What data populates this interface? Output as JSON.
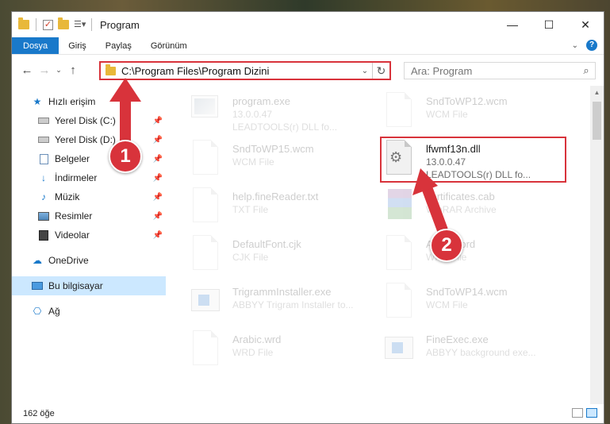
{
  "window": {
    "title": "Program",
    "controls": [
      "minimize",
      "maximize",
      "close"
    ]
  },
  "ribbon": {
    "tabs": [
      {
        "label": "Dosya",
        "active": true
      },
      {
        "label": "Giriş",
        "active": false
      },
      {
        "label": "Paylaş",
        "active": false
      },
      {
        "label": "Görünüm",
        "active": false
      }
    ]
  },
  "address": {
    "path": "C:\\Program Files\\Program Dizini"
  },
  "search": {
    "placeholder": "Ara: Program"
  },
  "nav": {
    "items": [
      {
        "label": "Hızlı erişim",
        "icon": "star-icon",
        "pinned": false
      },
      {
        "label": "Yerel Disk (C:)",
        "icon": "drive-icon",
        "pinned": true
      },
      {
        "label": "Yerel Disk (D:)",
        "icon": "drive-icon",
        "pinned": true
      },
      {
        "label": "Belgeler",
        "icon": "documents-icon",
        "pinned": true
      },
      {
        "label": "İndirmeler",
        "icon": "download-icon",
        "pinned": true
      },
      {
        "label": "Müzik",
        "icon": "music-icon",
        "pinned": true
      },
      {
        "label": "Resimler",
        "icon": "pictures-icon",
        "pinned": true
      },
      {
        "label": "Videolar",
        "icon": "videos-icon",
        "pinned": true
      },
      {
        "label": "OneDrive",
        "icon": "cloud-icon",
        "pinned": false
      },
      {
        "label": "Bu bilgisayar",
        "icon": "computer-icon",
        "pinned": false,
        "selected": true
      },
      {
        "label": "Ağ",
        "icon": "network-icon",
        "pinned": false
      }
    ]
  },
  "files": [
    {
      "name": "program.exe",
      "sub1": "13.0.0.47",
      "sub2": "LEADTOOLS(r) DLL fo...",
      "icon": "exe-icon",
      "highlighted": false
    },
    {
      "name": "SndToWP12.wcm",
      "sub1": "WCM File",
      "sub2": "",
      "icon": "file-icon",
      "highlighted": false
    },
    {
      "name": "SndToWP15.wcm",
      "sub1": "WCM File",
      "sub2": "",
      "icon": "file-icon",
      "highlighted": false
    },
    {
      "name": "lfwmf13n.dll",
      "sub1": "13.0.0.47",
      "sub2": "LEADTOOLS(r) DLL fo...",
      "icon": "dll-gear-icon",
      "highlighted": true
    },
    {
      "name": "help.fineReader.txt",
      "sub1": "TXT File",
      "sub2": "",
      "icon": "file-icon",
      "highlighted": false
    },
    {
      "name": "certificates.cab",
      "sub1": "WinRAR Archive",
      "sub2": "",
      "icon": "winrar-icon",
      "highlighted": false
    },
    {
      "name": "DefaultFont.cjk",
      "sub1": "CJK File",
      "sub2": "",
      "icon": "file-icon",
      "highlighted": false
    },
    {
      "name": "Aboutword",
      "sub1": "WRD File",
      "sub2": "",
      "icon": "file-icon",
      "highlighted": false
    },
    {
      "name": "TrigrammInstaller.exe",
      "sub1": "ABBYY Trigram Installer to...",
      "sub2": "",
      "icon": "app-icon",
      "highlighted": false
    },
    {
      "name": "SndToWP14.wcm",
      "sub1": "WCM File",
      "sub2": "",
      "icon": "file-icon",
      "highlighted": false
    },
    {
      "name": "Arabic.wrd",
      "sub1": "WRD File",
      "sub2": "",
      "icon": "file-icon",
      "highlighted": false
    },
    {
      "name": "FineExec.exe",
      "sub1": "ABBYY background exe...",
      "sub2": "",
      "icon": "app-icon",
      "highlighted": false
    }
  ],
  "status": {
    "count": "162 öğe"
  },
  "callouts": [
    "1",
    "2"
  ],
  "colors": {
    "accent": "#1979ca",
    "highlight_red": "#d8333b",
    "selection": "#cce8ff"
  }
}
